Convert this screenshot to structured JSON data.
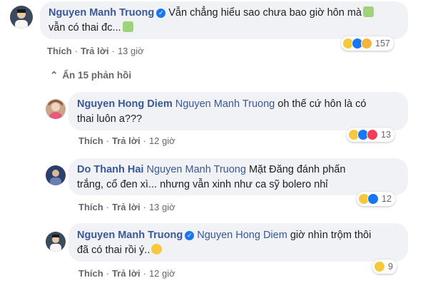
{
  "comments": [
    {
      "author": "Nguyen Manh Truong",
      "verified": true,
      "mention": "",
      "text_line1": "Vẫn chẳng hiểu sao chưa bao giờ hôn mà",
      "text_line2": "vẫn có thai đc...",
      "like_label": "Thích",
      "reply_label": "Trả lời",
      "time": "13 giờ",
      "reaction_count": "157",
      "reaction_icons": [
        "haha-icon",
        "like-icon",
        "care-icon"
      ],
      "avatar_color": "#3b4a5c"
    },
    {
      "author": "Nguyen Hong Diem",
      "verified": false,
      "mention": "Nguyen Manh Truong",
      "text_line1": "oh thế cứ hôn là có",
      "text_line2": "thai luôn a???",
      "like_label": "Thích",
      "reply_label": "Trả lời",
      "time": "12 giờ",
      "reaction_count": "13",
      "reaction_icons": [
        "haha-icon",
        "like-icon",
        "love-icon"
      ],
      "avatar_color": "#c9a58a"
    },
    {
      "author": "Do Thanh Hai",
      "verified": false,
      "mention": "Nguyen Manh Truong",
      "text_line1": "Mặt Đăng đánh phấn",
      "text_line2": "trắng, cổ đen xì... nhưng vẫn xinh như ca sỹ bolero nhỉ",
      "like_label": "Thích",
      "reply_label": "Trả lời",
      "time": "13 giờ",
      "reaction_count": "12",
      "reaction_icons": [
        "haha-icon",
        "like-icon"
      ],
      "avatar_color": "#2c3f6b"
    },
    {
      "author": "Nguyen Manh Truong",
      "verified": true,
      "mention": "Nguyen Hong Diem",
      "text_line1": "giờ nhìn trộm thôi",
      "text_line2": "đã có thai rồi ý..",
      "like_label": "Thích",
      "reply_label": "Trả lời",
      "time": "12 giờ",
      "reaction_count": "9",
      "reaction_icons": [
        "haha-icon"
      ],
      "avatar_color": "#3b4a5c"
    }
  ],
  "replies_toggle": "Ẩn 15 phản hồi",
  "colors": {
    "name": "#385898",
    "bubble": "#f0f2f5",
    "muted": "#65676b"
  }
}
